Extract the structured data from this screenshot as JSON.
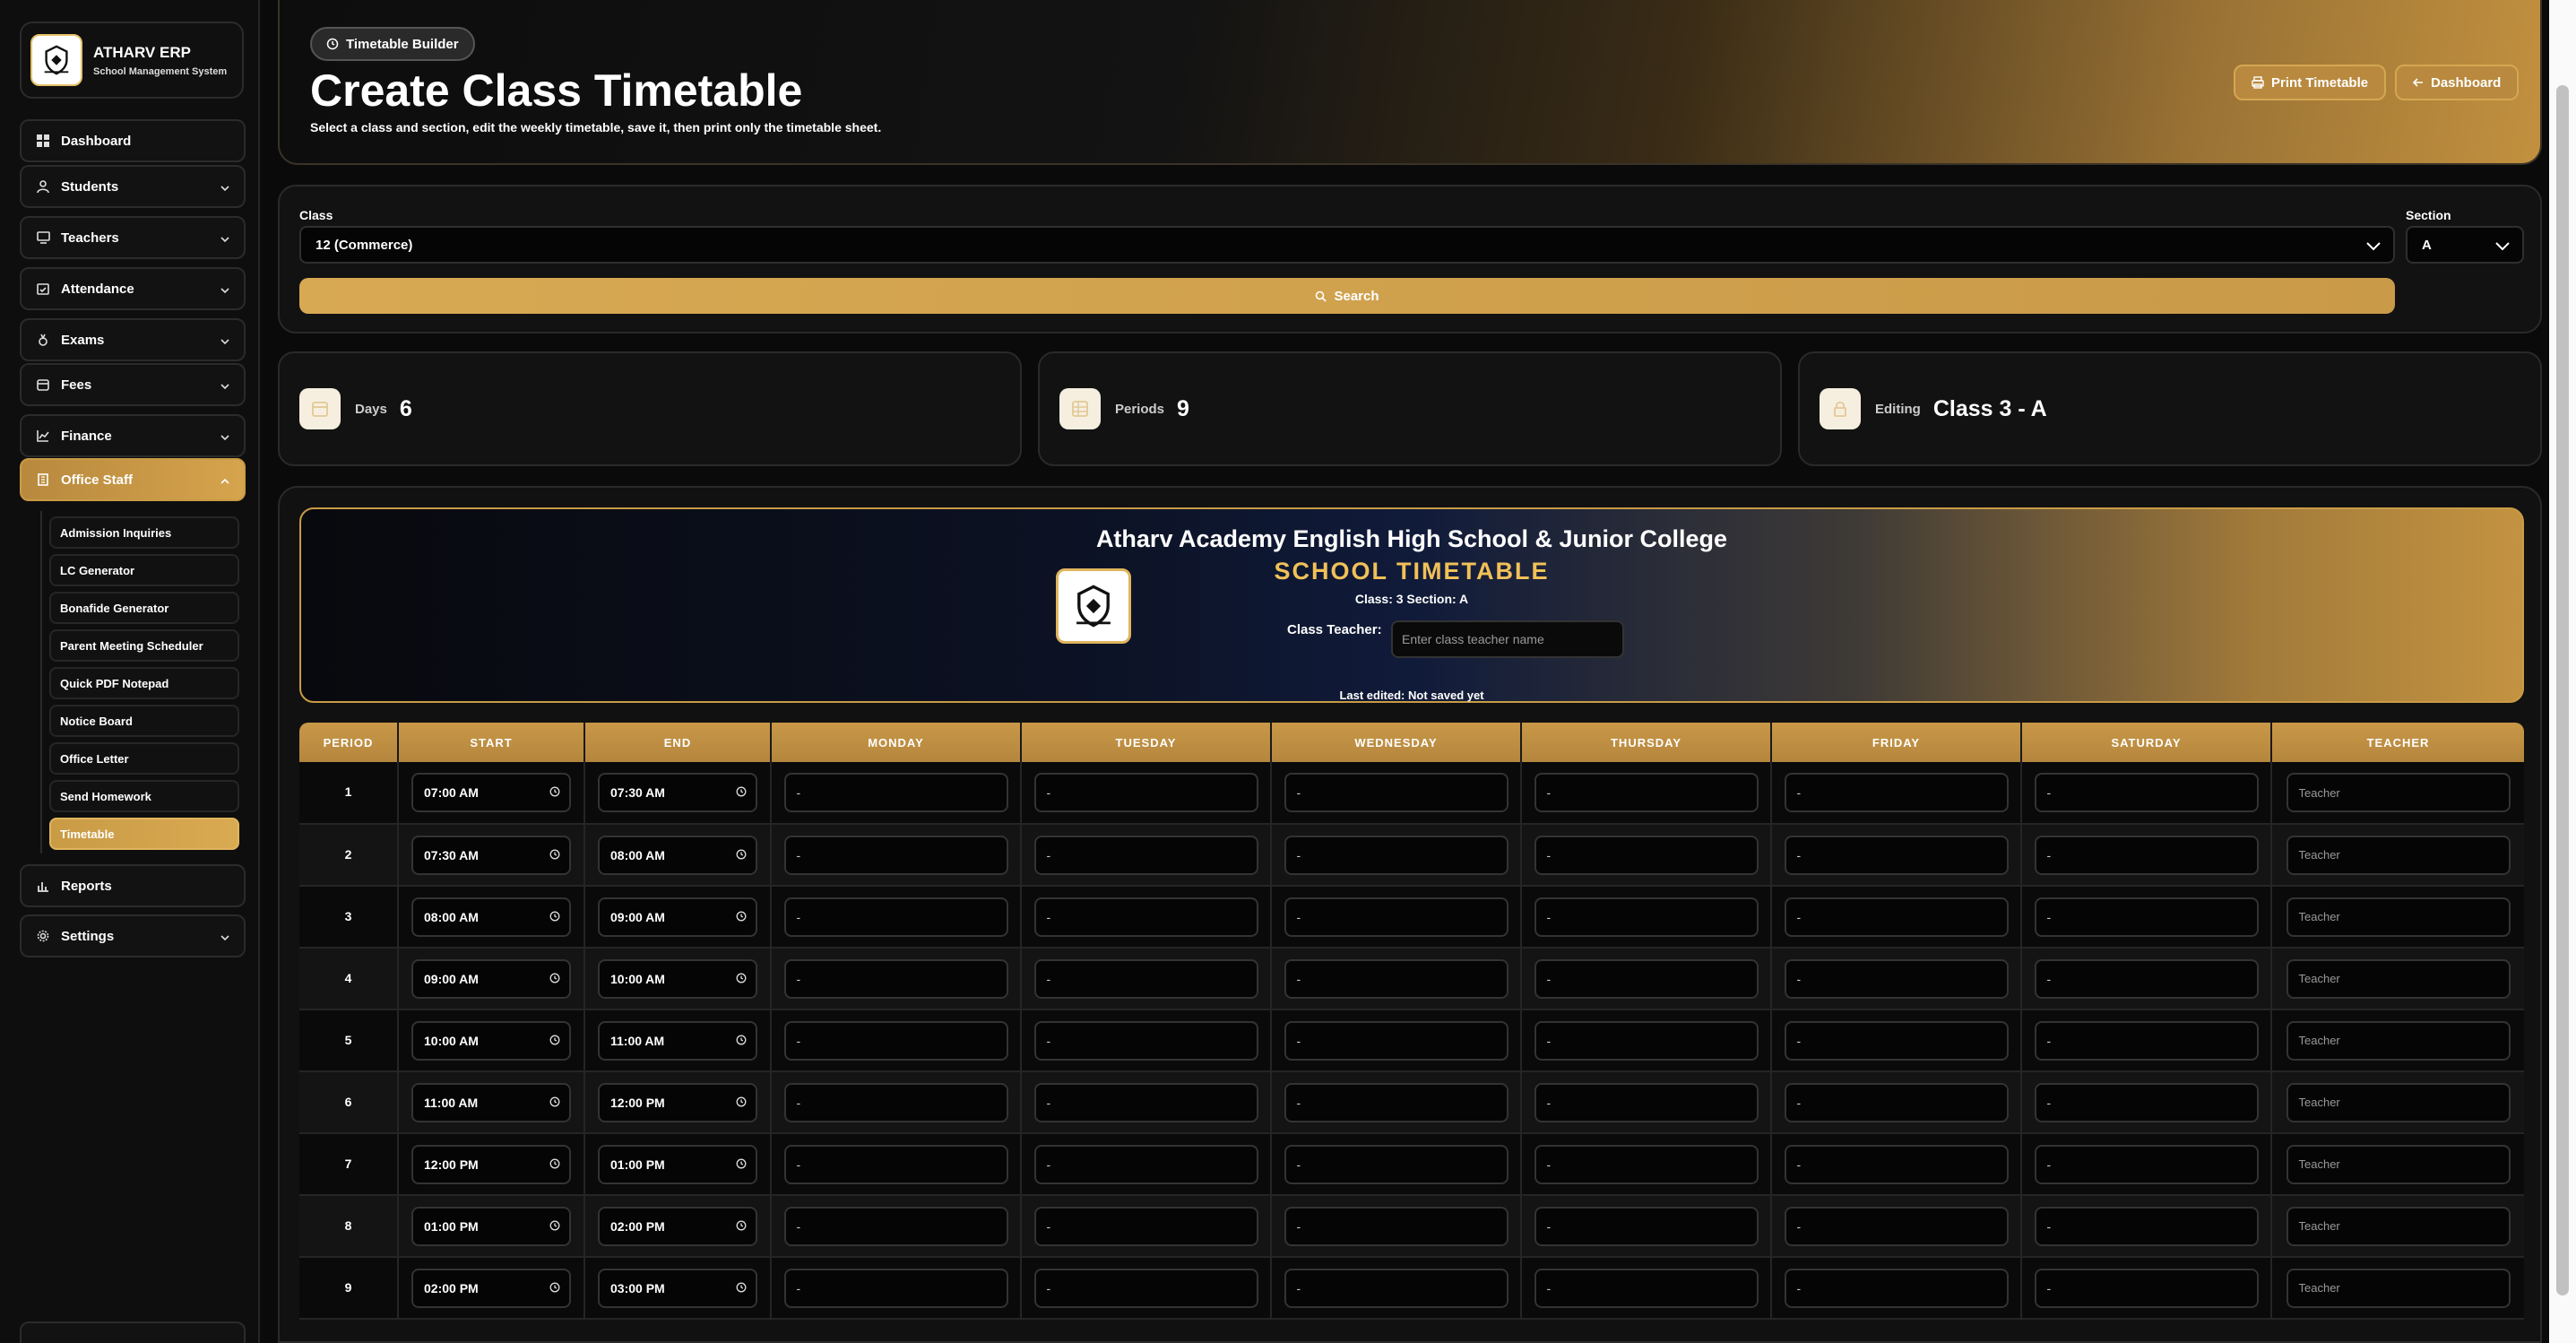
{
  "brand": {
    "title": "ATHARV ERP",
    "subtitle": "School Management System"
  },
  "sidebar": {
    "items": [
      {
        "label": "Dashboard",
        "icon": "dashboard-icon"
      },
      {
        "label": "Students",
        "icon": "user-icon"
      },
      {
        "label": "Teachers",
        "icon": "monitor-icon"
      },
      {
        "label": "Attendance",
        "icon": "calendar-check-icon"
      },
      {
        "label": "Exams",
        "icon": "exam-icon"
      },
      {
        "label": "Fees",
        "icon": "wallet-icon"
      },
      {
        "label": "Finance",
        "icon": "chart-line-icon"
      },
      {
        "label": "Office Staff",
        "icon": "building-icon"
      }
    ],
    "office_sub": [
      "Admission Inquiries",
      "LC Generator",
      "Bonafide Generator",
      "Parent Meeting Scheduler",
      "Quick PDF Notepad",
      "Notice Board",
      "Office Letter",
      "Send Homework",
      "Timetable"
    ],
    "bottom_items": [
      {
        "label": "Reports",
        "icon": "bar-chart-icon"
      },
      {
        "label": "Settings",
        "icon": "gear-icon"
      }
    ]
  },
  "header": {
    "pill": "Timetable Builder",
    "title": "Create Class Timetable",
    "desc": "Select a class and section, edit the weekly timetable, save it, then print only the timetable sheet.",
    "print_btn": "Print Timetable",
    "dash_btn": "Dashboard"
  },
  "filter": {
    "class_label": "Class",
    "class_value": "12 (Commerce)",
    "section_label": "Section",
    "section_value": "A",
    "search_btn": "Search"
  },
  "stats": [
    {
      "label": "Days",
      "value": "6"
    },
    {
      "label": "Periods",
      "value": "9"
    },
    {
      "label": "Editing",
      "value": "Class 3 - A"
    }
  ],
  "banner": {
    "school": "Atharv Academy English High School & Junior College",
    "title": "SCHOOL TIMETABLE",
    "class_line": "Class: 3   Section: A",
    "ct_label": "Class Teacher:",
    "ct_placeholder": "Enter class teacher name",
    "last_edited": "Last edited: Not saved yet"
  },
  "table": {
    "headers": [
      "PERIOD",
      "START",
      "END",
      "MONDAY",
      "TUESDAY",
      "WEDNESDAY",
      "THURSDAY",
      "FRIDAY",
      "SATURDAY",
      "TEACHER"
    ],
    "cell_placeholder": "-",
    "teacher_placeholder": "Teacher",
    "rows": [
      {
        "period": "1",
        "start": "07:00 AM",
        "end": "07:30 AM"
      },
      {
        "period": "2",
        "start": "07:30 AM",
        "end": "08:00 AM"
      },
      {
        "period": "3",
        "start": "08:00 AM",
        "end": "09:00 AM"
      },
      {
        "period": "4",
        "start": "09:00 AM",
        "end": "10:00 AM"
      },
      {
        "period": "5",
        "start": "10:00 AM",
        "end": "11:00 AM"
      },
      {
        "period": "6",
        "start": "11:00 AM",
        "end": "12:00 PM"
      },
      {
        "period": "7",
        "start": "12:00 PM",
        "end": "01:00 PM"
      },
      {
        "period": "8",
        "start": "01:00 PM",
        "end": "02:00 PM"
      },
      {
        "period": "9",
        "start": "02:00 PM",
        "end": "03:00 PM"
      }
    ]
  },
  "colors": {
    "accent": "#c99b45",
    "background": "#0a0a0a"
  }
}
